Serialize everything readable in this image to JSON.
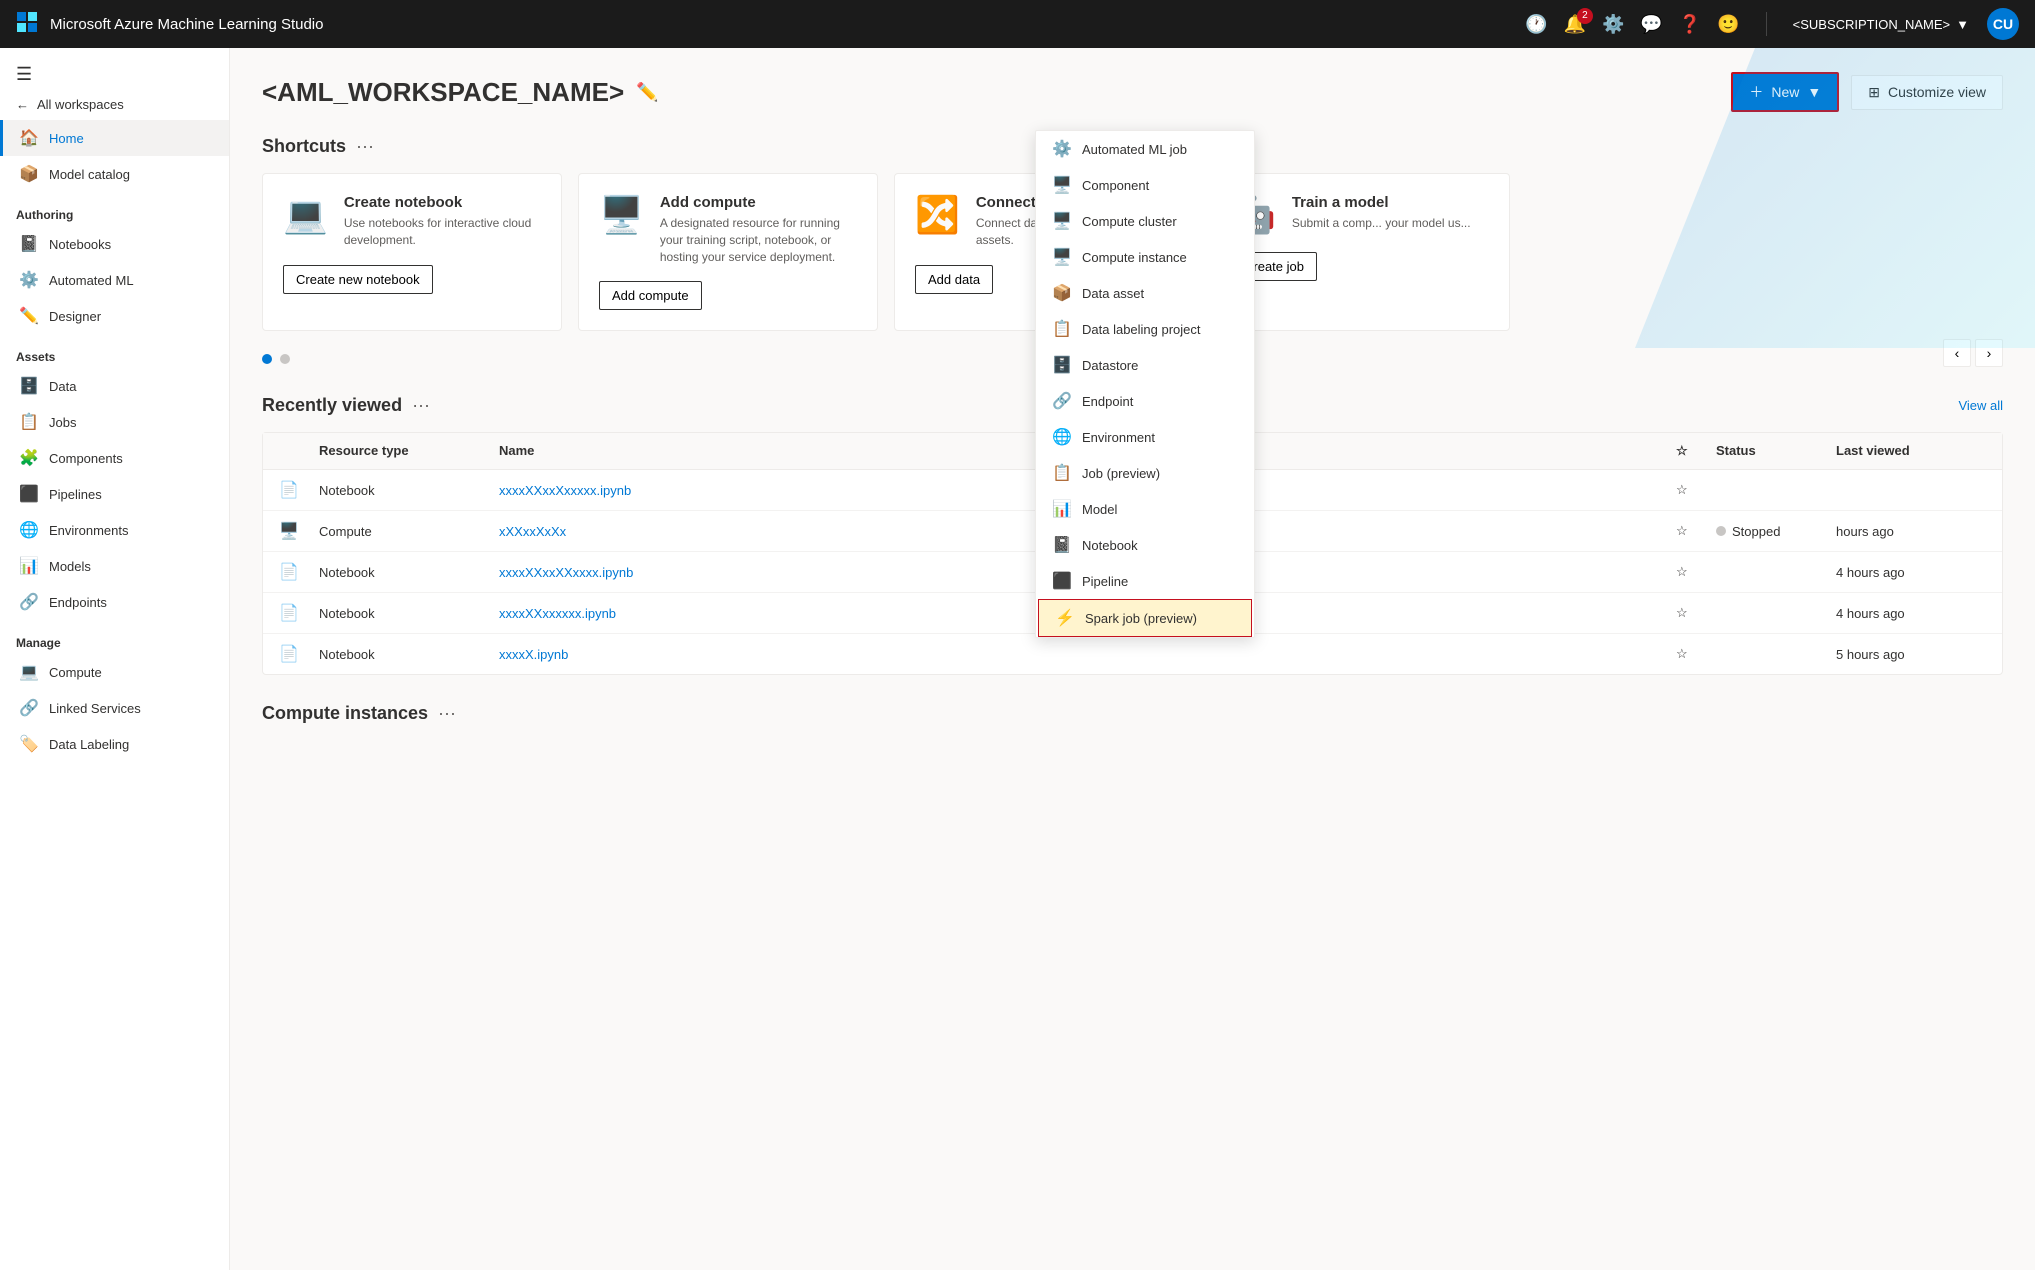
{
  "app": {
    "title": "Microsoft Azure Machine Learning Studio"
  },
  "topnav": {
    "subscription": "<SUBSCRIPTION_NAME>",
    "avatar_initials": "CU",
    "notification_count": "2"
  },
  "sidebar": {
    "back_label": "All workspaces",
    "nav_items": [
      {
        "id": "home",
        "label": "Home",
        "icon": "🏠",
        "active": true
      },
      {
        "id": "model-catalog",
        "label": "Model catalog",
        "icon": "📦",
        "active": false
      }
    ],
    "sections": [
      {
        "label": "Authoring",
        "items": [
          {
            "id": "notebooks",
            "label": "Notebooks",
            "icon": "📓"
          },
          {
            "id": "automated-ml",
            "label": "Automated ML",
            "icon": "⚙️"
          },
          {
            "id": "designer",
            "label": "Designer",
            "icon": "✏️"
          }
        ]
      },
      {
        "label": "Assets",
        "items": [
          {
            "id": "data",
            "label": "Data",
            "icon": "🗄️"
          },
          {
            "id": "jobs",
            "label": "Jobs",
            "icon": "📋"
          },
          {
            "id": "components",
            "label": "Components",
            "icon": "🧩"
          },
          {
            "id": "pipelines",
            "label": "Pipelines",
            "icon": "⬛"
          },
          {
            "id": "environments",
            "label": "Environments",
            "icon": "🌐"
          },
          {
            "id": "models",
            "label": "Models",
            "icon": "📊"
          },
          {
            "id": "endpoints",
            "label": "Endpoints",
            "icon": "🔗"
          }
        ]
      },
      {
        "label": "Manage",
        "items": [
          {
            "id": "compute",
            "label": "Compute",
            "icon": "💻"
          },
          {
            "id": "linked-services",
            "label": "Linked Services",
            "icon": "🔗"
          },
          {
            "id": "data-labeling",
            "label": "Data Labeling",
            "icon": "🏷️"
          }
        ]
      }
    ]
  },
  "page": {
    "workspace_name": "<AML_WORKSPACE_NAME>",
    "new_button": "New",
    "customize_button": "Customize view"
  },
  "shortcuts": {
    "title": "Shortcuts",
    "cards": [
      {
        "title": "Create notebook",
        "description": "Use notebooks for interactive cloud development.",
        "button_label": "Create new notebook",
        "icon": "💻"
      },
      {
        "title": "Add compute",
        "description": "A designated resource for running your training script, notebook, or hosting your service deployment.",
        "button_label": "Add compute",
        "icon": "🖥️"
      },
      {
        "title": "Connect data",
        "description": "Connect data files, public U... assets.",
        "button_label": "Add data",
        "icon": "🔀"
      },
      {
        "title": "Train a model",
        "description": "Submit a comp... your model us...",
        "button_label": "Create job",
        "icon": "🤖"
      }
    ]
  },
  "recently_viewed": {
    "title": "Recently viewed",
    "view_all_label": "View all",
    "columns": [
      "",
      "Resource type",
      "Name",
      "",
      "Status",
      "Last viewed"
    ],
    "rows": [
      {
        "icon": "📄",
        "resource_type": "Notebook",
        "name": "xxxxXXxxXxxxxx.ipynb",
        "status": "",
        "last_viewed": ""
      },
      {
        "icon": "🖥️",
        "resource_type": "Compute",
        "name": "xXXxxXxXx",
        "status": "Stopped",
        "last_viewed": "hours ago"
      },
      {
        "icon": "📄",
        "resource_type": "Notebook",
        "name": "xxxxXXxxXXxxxx.ipynb",
        "status": "",
        "last_viewed": "4 hours ago"
      },
      {
        "icon": "📄",
        "resource_type": "Notebook",
        "name": "xxxxXXxxxxxx.ipynb",
        "status": "",
        "last_viewed": "4 hours ago"
      },
      {
        "icon": "📄",
        "resource_type": "Notebook",
        "name": "xxxxX.ipynb",
        "status": "",
        "last_viewed": "5 hours ago"
      }
    ]
  },
  "compute_instances": {
    "title": "Compute instances"
  },
  "dropdown_menu": {
    "items": [
      {
        "id": "automated-ml-job",
        "label": "Automated ML job",
        "icon": "⚙️"
      },
      {
        "id": "component",
        "label": "Component",
        "icon": "🖥️"
      },
      {
        "id": "compute-cluster",
        "label": "Compute cluster",
        "icon": "🖥️"
      },
      {
        "id": "compute-instance",
        "label": "Compute instance",
        "icon": "🖥️"
      },
      {
        "id": "data-asset",
        "label": "Data asset",
        "icon": "📦"
      },
      {
        "id": "data-labeling-project",
        "label": "Data labeling project",
        "icon": "📋"
      },
      {
        "id": "datastore",
        "label": "Datastore",
        "icon": "🗄️"
      },
      {
        "id": "endpoint",
        "label": "Endpoint",
        "icon": "🔗"
      },
      {
        "id": "environment",
        "label": "Environment",
        "icon": "🌐"
      },
      {
        "id": "job-preview",
        "label": "Job (preview)",
        "icon": "📋"
      },
      {
        "id": "model",
        "label": "Model",
        "icon": "📊"
      },
      {
        "id": "notebook",
        "label": "Notebook",
        "icon": "📓"
      },
      {
        "id": "pipeline",
        "label": "Pipeline",
        "icon": "⬛"
      },
      {
        "id": "spark-job-preview",
        "label": "Spark job (preview)",
        "icon": "⚡",
        "highlighted": true
      }
    ]
  }
}
